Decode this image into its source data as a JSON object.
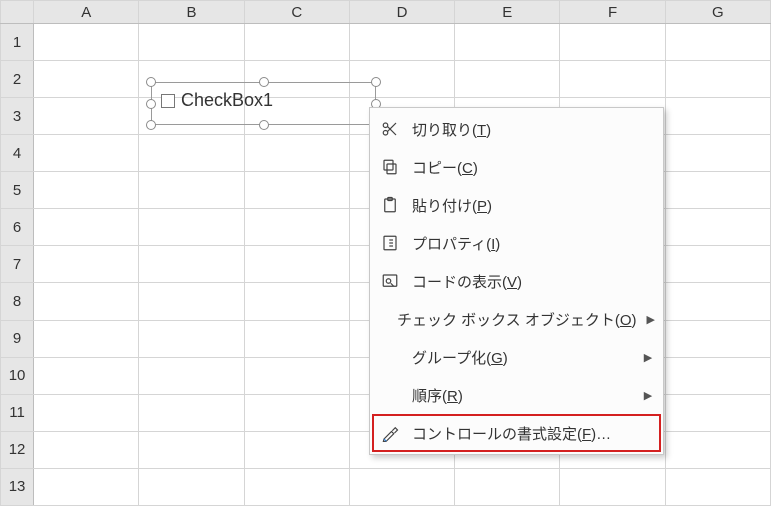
{
  "columns": [
    "A",
    "B",
    "C",
    "D",
    "E",
    "F",
    "G"
  ],
  "rows": [
    "1",
    "2",
    "3",
    "4",
    "5",
    "6",
    "7",
    "8",
    "9",
    "10",
    "11",
    "12",
    "13"
  ],
  "control": {
    "label": "CheckBox1"
  },
  "menu": {
    "cut": "切り取り(T)",
    "copy": "コピー(C)",
    "paste": "貼り付け(P)",
    "properties": "プロパティ(I)",
    "viewcode": "コードの表示(V)",
    "object": "チェック ボックス オブジェクト(O)",
    "group": "グループ化(G)",
    "order": "順序(R)",
    "format": "コントロールの書式設定(F)…"
  }
}
